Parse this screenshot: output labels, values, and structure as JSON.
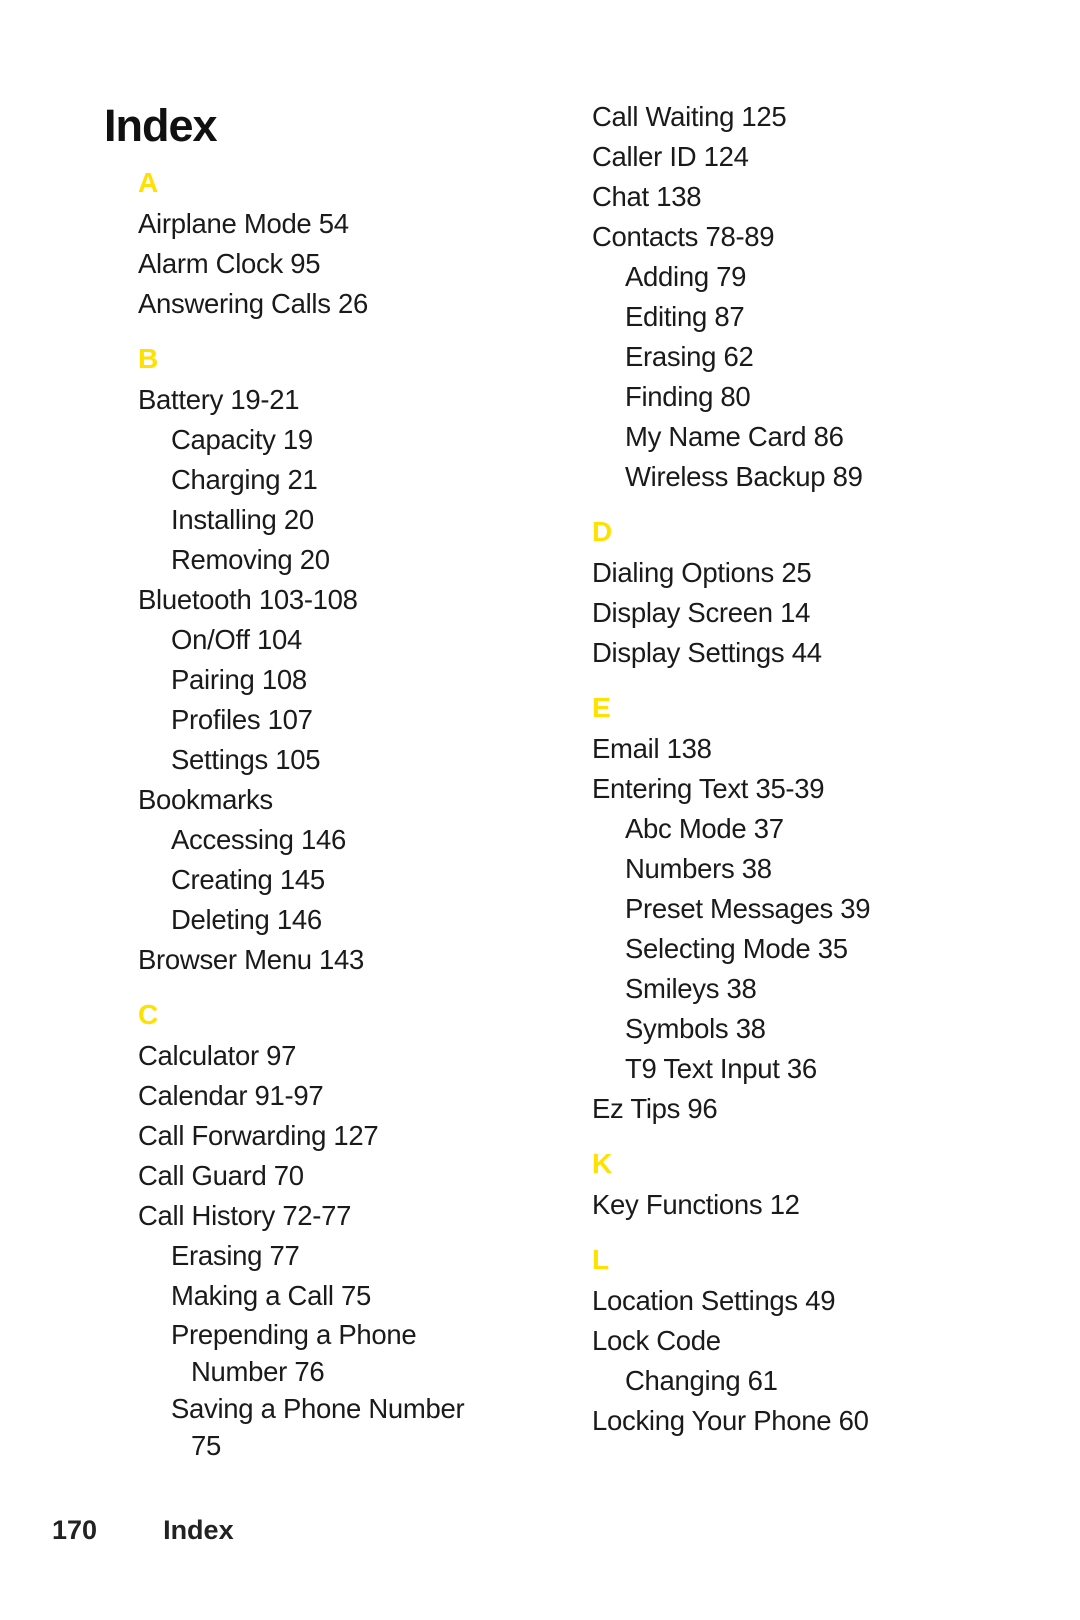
{
  "page": {
    "title": "Index",
    "accent_color": "#FFE100",
    "footer": {
      "page_number": "170",
      "section": "Index"
    }
  },
  "left_column": [
    {
      "letter": "A",
      "entries": [
        {
          "text": "Airplane Mode 54",
          "level": 0
        },
        {
          "text": "Alarm Clock 95",
          "level": 0
        },
        {
          "text": "Answering Calls 26",
          "level": 0
        }
      ]
    },
    {
      "letter": "B",
      "entries": [
        {
          "text": "Battery 19-21",
          "level": 0
        },
        {
          "text": "Capacity 19",
          "level": 1
        },
        {
          "text": "Charging 21",
          "level": 1
        },
        {
          "text": "Installing 20",
          "level": 1
        },
        {
          "text": "Removing 20",
          "level": 1
        },
        {
          "text": "Bluetooth 103-108",
          "level": 0
        },
        {
          "text": "On/Off 104",
          "level": 1
        },
        {
          "text": "Pairing 108",
          "level": 1
        },
        {
          "text": "Profiles 107",
          "level": 1
        },
        {
          "text": "Settings 105",
          "level": 1
        },
        {
          "text": "Bookmarks",
          "level": 0
        },
        {
          "text": "Accessing 146",
          "level": 1
        },
        {
          "text": "Creating 145",
          "level": 1
        },
        {
          "text": "Deleting 146",
          "level": 1
        },
        {
          "text": "Browser Menu 143",
          "level": 0
        }
      ]
    },
    {
      "letter": "C",
      "entries": [
        {
          "text": "Calculator 97",
          "level": 0
        },
        {
          "text": "Calendar 91-97",
          "level": 0
        },
        {
          "text": "Call Forwarding 127",
          "level": 0
        },
        {
          "text": "Call Guard 70",
          "level": 0
        },
        {
          "text": "Call History 72-77",
          "level": 0
        },
        {
          "text": "Erasing 77",
          "level": 1
        },
        {
          "text": "Making a Call 75",
          "level": 1
        },
        {
          "text": "Prepending a Phone",
          "cont": "Number 76",
          "level": 1
        },
        {
          "text": "Saving a Phone Number",
          "cont": "75",
          "level": 1
        }
      ]
    }
  ],
  "right_column": [
    {
      "letter": "",
      "entries": [
        {
          "text": "Call Waiting 125",
          "level": 0
        },
        {
          "text": "Caller ID 124",
          "level": 0
        },
        {
          "text": "Chat 138",
          "level": 0
        },
        {
          "text": "Contacts 78-89",
          "level": 0
        },
        {
          "text": "Adding 79",
          "level": 1
        },
        {
          "text": "Editing 87",
          "level": 1
        },
        {
          "text": "Erasing 62",
          "level": 1
        },
        {
          "text": "Finding 80",
          "level": 1
        },
        {
          "text": "My Name Card 86",
          "level": 1
        },
        {
          "text": "Wireless Backup 89",
          "level": 1
        }
      ]
    },
    {
      "letter": "D",
      "entries": [
        {
          "text": "Dialing Options 25",
          "level": 0
        },
        {
          "text": "Display Screen 14",
          "level": 0
        },
        {
          "text": "Display Settings 44",
          "level": 0
        }
      ]
    },
    {
      "letter": "E",
      "entries": [
        {
          "text": "Email 138",
          "level": 0
        },
        {
          "text": "Entering Text 35-39",
          "level": 0
        },
        {
          "text": "Abc Mode 37",
          "level": 1
        },
        {
          "text": "Numbers 38",
          "level": 1
        },
        {
          "text": "Preset Messages 39",
          "level": 1
        },
        {
          "text": "Selecting Mode 35",
          "level": 1
        },
        {
          "text": "Smileys 38",
          "level": 1
        },
        {
          "text": "Symbols 38",
          "level": 1
        },
        {
          "text": "T9 Text Input 36",
          "level": 1
        },
        {
          "text": "Ez Tips 96",
          "level": 0
        }
      ]
    },
    {
      "letter": "K",
      "entries": [
        {
          "text": "Key Functions 12",
          "level": 0
        }
      ]
    },
    {
      "letter": "L",
      "entries": [
        {
          "text": "Location Settings 49",
          "level": 0
        },
        {
          "text": "Lock Code",
          "level": 0
        },
        {
          "text": "Changing 61",
          "level": 1
        },
        {
          "text": "Locking Your Phone 60",
          "level": 0
        }
      ]
    }
  ]
}
